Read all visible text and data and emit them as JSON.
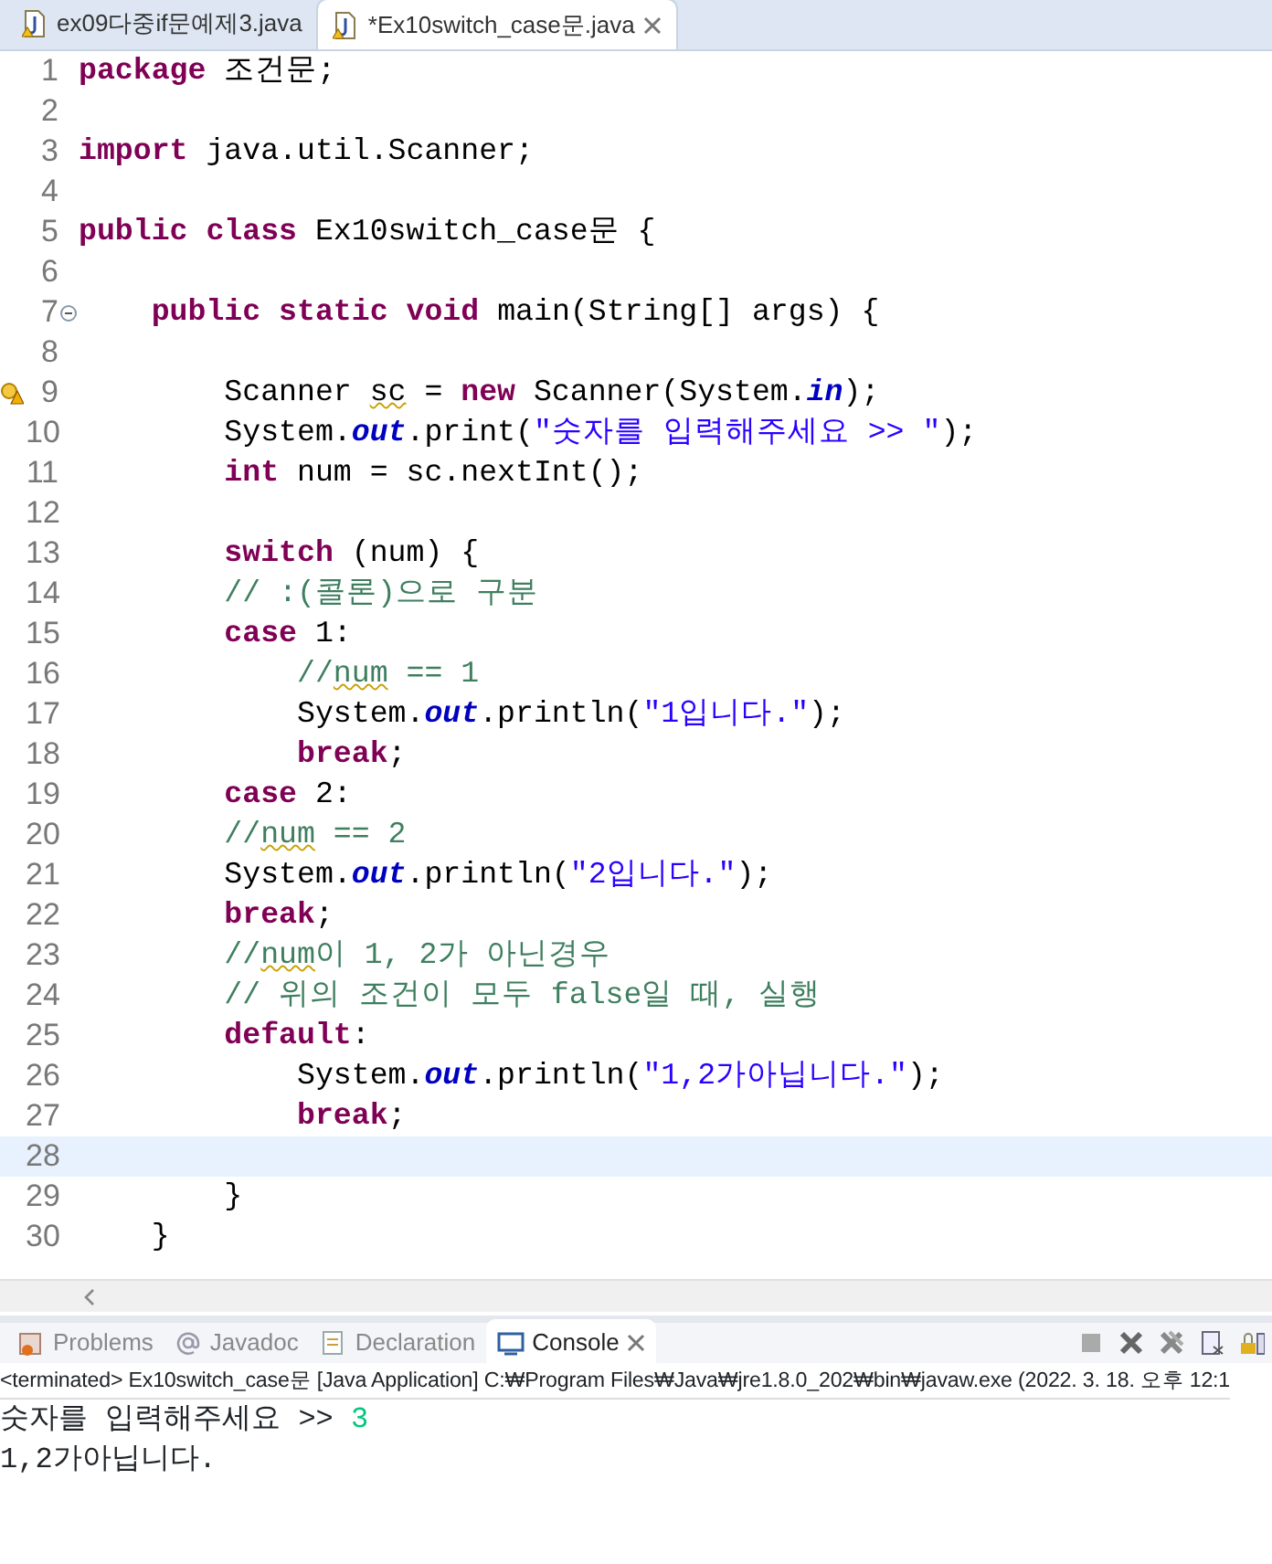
{
  "editor_tabs": [
    {
      "label": "ex09다중if문예제3.java",
      "selected": false
    },
    {
      "label": "*Ex10switch_case문.java",
      "selected": true
    }
  ],
  "code_lines": [
    {
      "number": "1",
      "tokens": [
        {
          "kind": "keyword",
          "text": "package"
        },
        {
          "kind": "plain",
          "text": " 조건문;"
        }
      ]
    },
    {
      "number": "2"
    },
    {
      "number": "3",
      "tokens": [
        {
          "kind": "keyword",
          "text": "import"
        },
        {
          "kind": "plain",
          "text": " java.util.Scanner;"
        }
      ]
    },
    {
      "number": "4"
    },
    {
      "number": "5",
      "tokens": [
        {
          "kind": "keyword",
          "text": "public"
        },
        {
          "kind": "keyword",
          "text": " class"
        },
        {
          "kind": "plain",
          "text": " Ex10switch_case문 {"
        }
      ]
    },
    {
      "number": "6"
    },
    {
      "number": "7",
      "foldable": true,
      "tokens": [
        {
          "kind": "keyword",
          "text": "    public"
        },
        {
          "kind": "keyword",
          "text": " static"
        },
        {
          "kind": "keyword",
          "text": " void"
        },
        {
          "kind": "plain",
          "text": " main(String[] args) {"
        }
      ]
    },
    {
      "number": "8"
    },
    {
      "number": "9",
      "warning": true,
      "tokens": [
        {
          "kind": "plain",
          "text": "        Scanner "
        },
        {
          "kind": "flagged",
          "text": "sc"
        },
        {
          "kind": "plain",
          "text": " = "
        },
        {
          "kind": "keyword",
          "text": "new"
        },
        {
          "kind": "plain",
          "text": " Scanner(System."
        },
        {
          "kind": "field",
          "text": "in"
        },
        {
          "kind": "plain",
          "text": ");"
        }
      ]
    },
    {
      "number": "10",
      "tokens": [
        {
          "kind": "plain",
          "text": "        System."
        },
        {
          "kind": "field",
          "text": "out"
        },
        {
          "kind": "plain",
          "text": ".print("
        },
        {
          "kind": "string",
          "text": "\"숫자를 입력해주세요 >> \""
        },
        {
          "kind": "plain",
          "text": ");"
        }
      ]
    },
    {
      "number": "11",
      "tokens": [
        {
          "kind": "keyword",
          "text": "        int"
        },
        {
          "kind": "plain",
          "text": " num = sc.nextInt();"
        }
      ]
    },
    {
      "number": "12"
    },
    {
      "number": "13",
      "tokens": [
        {
          "kind": "keyword",
          "text": "        switch"
        },
        {
          "kind": "plain",
          "text": " (num) {"
        }
      ]
    },
    {
      "number": "14",
      "tokens": [
        {
          "kind": "comment",
          "text": "        // :(콜론)으로 구분"
        }
      ]
    },
    {
      "number": "15",
      "tokens": [
        {
          "kind": "keyword",
          "text": "        case"
        },
        {
          "kind": "plain",
          "text": " 1:"
        }
      ]
    },
    {
      "number": "16",
      "tokens": [
        {
          "kind": "comment",
          "text": "            //"
        },
        {
          "kind": "flagged_comment",
          "text": "num"
        },
        {
          "kind": "comment",
          "text": " == 1"
        }
      ]
    },
    {
      "number": "17",
      "tokens": [
        {
          "kind": "plain",
          "text": "            System."
        },
        {
          "kind": "field",
          "text": "out"
        },
        {
          "kind": "plain",
          "text": ".println("
        },
        {
          "kind": "string",
          "text": "\"1입니다.\""
        },
        {
          "kind": "plain",
          "text": ");"
        }
      ]
    },
    {
      "number": "18",
      "tokens": [
        {
          "kind": "keyword",
          "text": "            break"
        },
        {
          "kind": "plain",
          "text": ";"
        }
      ]
    },
    {
      "number": "19",
      "tokens": [
        {
          "kind": "keyword",
          "text": "        case"
        },
        {
          "kind": "plain",
          "text": " 2:"
        }
      ]
    },
    {
      "number": "20",
      "tokens": [
        {
          "kind": "comment",
          "text": "        //"
        },
        {
          "kind": "flagged_comment",
          "text": "num"
        },
        {
          "kind": "comment",
          "text": " == 2"
        }
      ]
    },
    {
      "number": "21",
      "tokens": [
        {
          "kind": "plain",
          "text": "        System."
        },
        {
          "kind": "field",
          "text": "out"
        },
        {
          "kind": "plain",
          "text": ".println("
        },
        {
          "kind": "string",
          "text": "\"2입니다.\""
        },
        {
          "kind": "plain",
          "text": ");"
        }
      ]
    },
    {
      "number": "22",
      "tokens": [
        {
          "kind": "keyword",
          "text": "        break"
        },
        {
          "kind": "plain",
          "text": ";"
        }
      ]
    },
    {
      "number": "23",
      "tokens": [
        {
          "kind": "comment",
          "text": "        //"
        },
        {
          "kind": "flagged_comment",
          "text": "num"
        },
        {
          "kind": "comment",
          "text": "이 1, 2가 아닌경우"
        }
      ]
    },
    {
      "number": "24",
      "tokens": [
        {
          "kind": "comment",
          "text": "        // 위의 조건이 모두 false일 때, 실행"
        }
      ]
    },
    {
      "number": "25",
      "tokens": [
        {
          "kind": "keyword",
          "text": "        default"
        },
        {
          "kind": "plain",
          "text": ":"
        }
      ]
    },
    {
      "number": "26",
      "tokens": [
        {
          "kind": "plain",
          "text": "            System."
        },
        {
          "kind": "field",
          "text": "out"
        },
        {
          "kind": "plain",
          "text": ".println("
        },
        {
          "kind": "string",
          "text": "\"1,2가아닙니다.\""
        },
        {
          "kind": "plain",
          "text": ");"
        }
      ]
    },
    {
      "number": "27",
      "tokens": [
        {
          "kind": "keyword",
          "text": "            break"
        },
        {
          "kind": "plain",
          "text": ";"
        }
      ]
    },
    {
      "number": "28",
      "current": true
    },
    {
      "number": "29",
      "tokens": [
        {
          "kind": "plain",
          "text": "        }"
        }
      ]
    },
    {
      "number": "30",
      "tokens": [
        {
          "kind": "plain",
          "text": "    }"
        }
      ]
    }
  ],
  "view_tabs": [
    {
      "label": "Problems",
      "selected": false
    },
    {
      "label": "Javadoc",
      "selected": false
    },
    {
      "label": "Declaration",
      "selected": false
    },
    {
      "label": "Console",
      "selected": true
    }
  ],
  "console": {
    "header": "<terminated> Ex10switch_case문 [Java Application] C:₩Program Files₩Java₩jre1.8.0_202₩bin₩javaw.exe (2022. 3. 18. 오후 12:1",
    "lines": [
      [
        {
          "kind": "output",
          "text": "숫자를 입력해주세요 >> "
        },
        {
          "kind": "input",
          "text": "3"
        }
      ],
      [
        {
          "kind": "output",
          "text": "1,2가아닙니다."
        }
      ]
    ]
  }
}
